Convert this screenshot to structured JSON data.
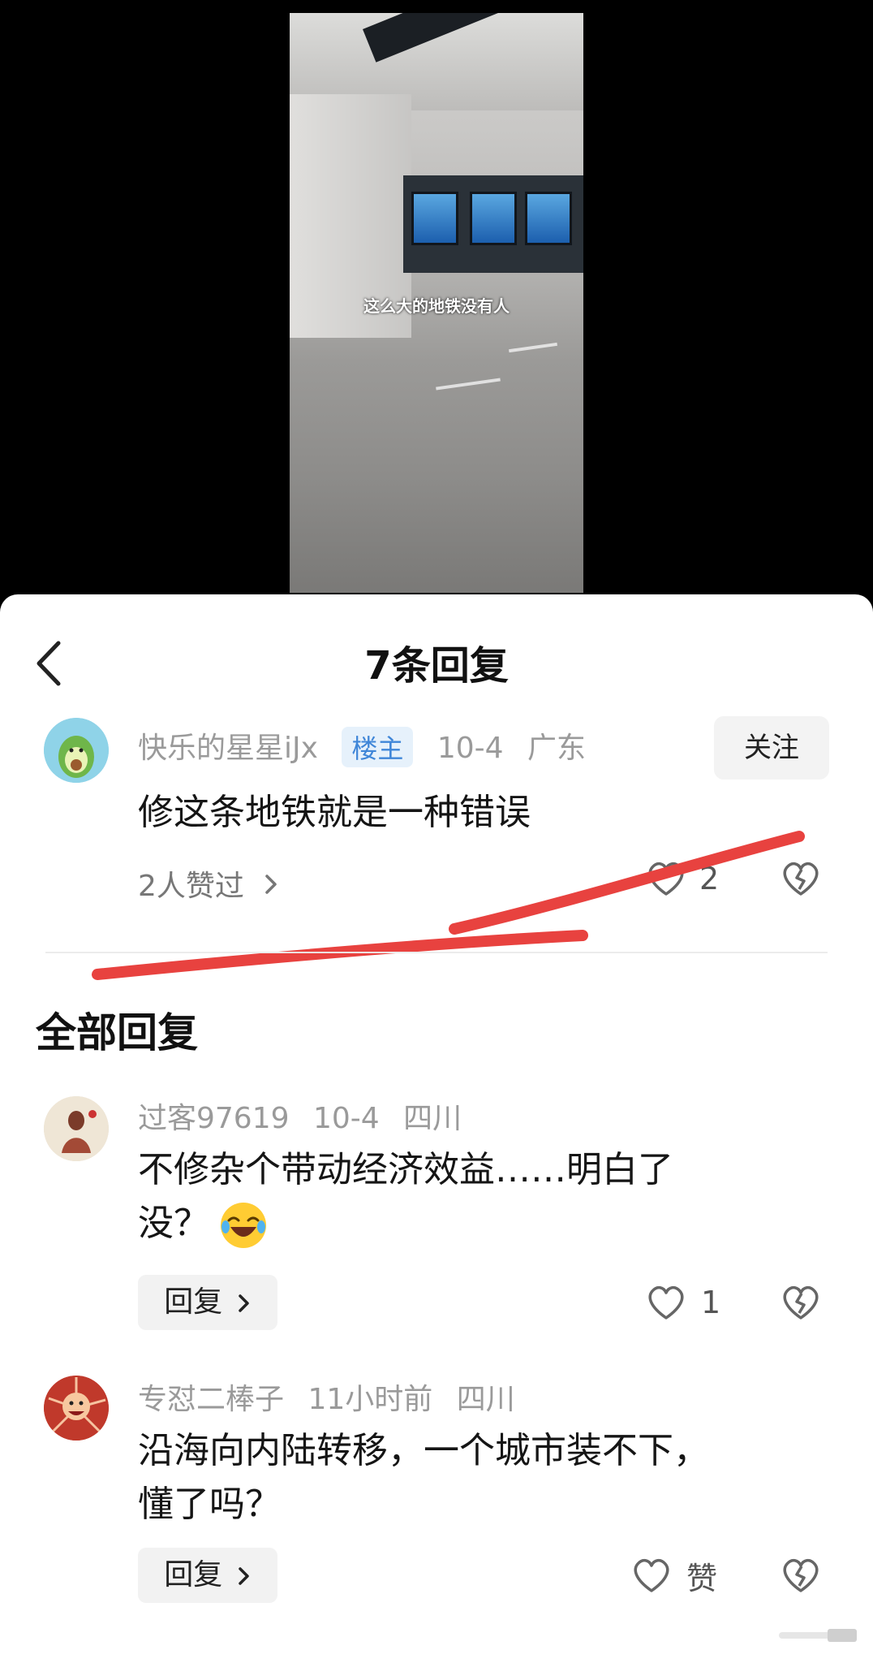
{
  "video": {
    "caption": "这么大的地铁没有人"
  },
  "sheet": {
    "title": "7条回复"
  },
  "main_comment": {
    "username": "快乐的星星iJx",
    "badge": "楼主",
    "date": "10-4",
    "location": "广东",
    "follow_label": "关注",
    "text": "修这条地铁就是一种错误",
    "likers_text": "2人赞过",
    "like_count": "2"
  },
  "section_title": "全部回复",
  "replies": [
    {
      "username": "过客97619",
      "date": "10-4",
      "location": "四川",
      "text_line1": "不修杂个带动经济效益……明白了",
      "text_line2": "没？",
      "reply_label": "回复",
      "like_count": "1"
    },
    {
      "username": "专怼二棒子",
      "date": "11小时前",
      "location": "四川",
      "text_line1": "沿海向内陆转移，一个城市装不下，",
      "text_line2": "懂了吗？",
      "reply_label": "回复",
      "like_label": "赞"
    }
  ],
  "colors": {
    "accent_badge": "#3f86d8",
    "annotation_red": "#e8423f"
  },
  "icons": [
    "back-chevron-icon",
    "heart-icon",
    "broken-heart-icon",
    "chevron-right-icon",
    "laughing-emoji-icon"
  ]
}
